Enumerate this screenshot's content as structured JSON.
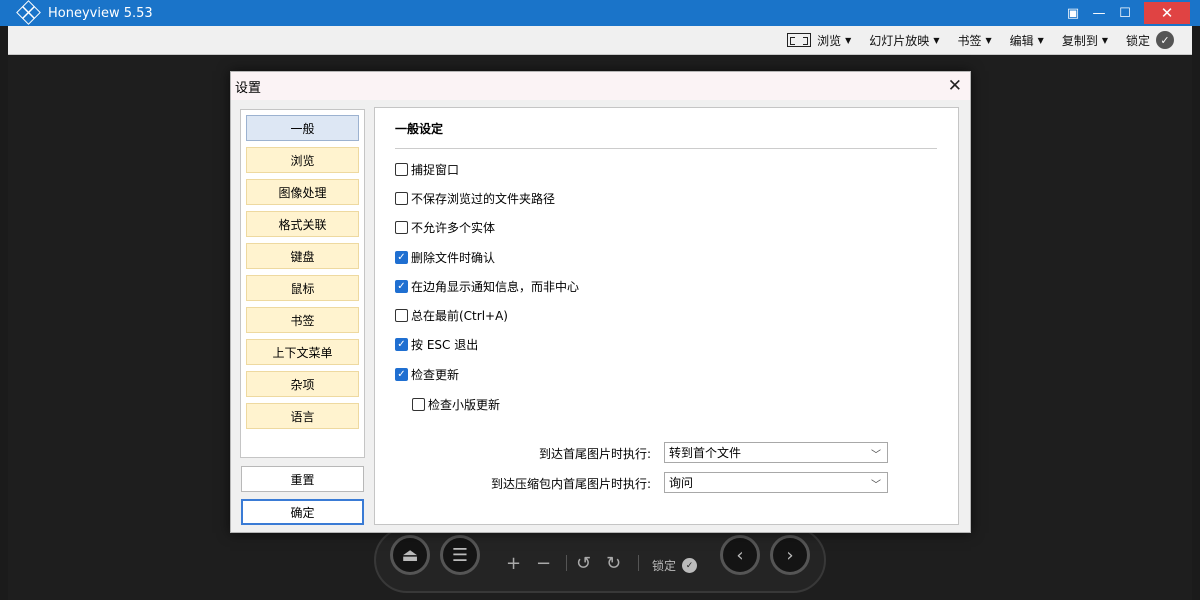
{
  "window": {
    "title": "Honeyview 5.53"
  },
  "toolbar": {
    "items": [
      {
        "label": "浏览",
        "icon": "fit-window-icon"
      },
      {
        "label": "幻灯片放映"
      },
      {
        "label": "书签"
      },
      {
        "label": "编辑"
      },
      {
        "label": "复制到"
      }
    ],
    "lock_label": "锁定"
  },
  "controller": {
    "lock_label": "锁定"
  },
  "dialog": {
    "title": "设置",
    "nav": [
      "一般",
      "浏览",
      "图像处理",
      "格式关联",
      "键盘",
      "鼠标",
      "书签",
      "上下文菜单",
      "杂项",
      "语言"
    ],
    "active_nav": "一般",
    "reset_label": "重置",
    "ok_label": "确定",
    "section_title": "一般设定",
    "options": [
      {
        "label": "捕捉窗口",
        "checked": false
      },
      {
        "label": "不保存浏览过的文件夹路径",
        "checked": false
      },
      {
        "label": "不允许多个实体",
        "checked": false
      },
      {
        "label": "删除文件时确认",
        "checked": true
      },
      {
        "label": "在边角显示通知信息，而非中心",
        "checked": true
      },
      {
        "label": "总在最前(Ctrl+A)",
        "checked": false
      },
      {
        "label": "按 ESC 退出",
        "checked": true
      },
      {
        "label": "检查更新",
        "checked": true
      },
      {
        "label": "检查小版更新",
        "checked": false
      }
    ],
    "selects": [
      {
        "label": "到达首尾图片时执行:",
        "value": "转到首个文件"
      },
      {
        "label": "到达压缩包内首尾图片时执行:",
        "value": "询问"
      }
    ]
  }
}
